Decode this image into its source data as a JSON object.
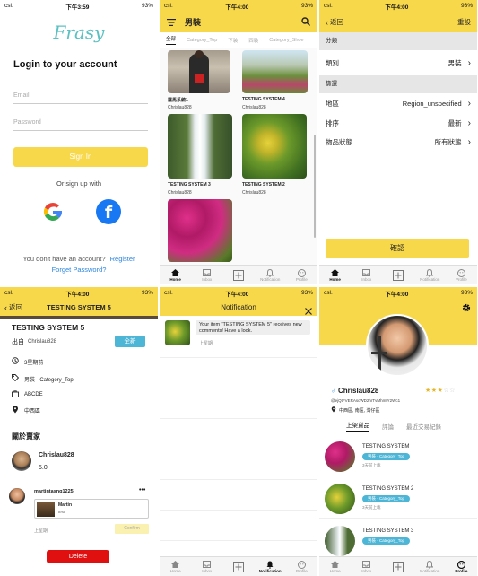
{
  "p1": {
    "status": {
      "carrier": "csl.",
      "time": "下午3:59",
      "battery": "93%"
    },
    "logo": "Frasy",
    "heading": "Login to your account",
    "email_placeholder": "Email",
    "password_placeholder": "Password",
    "signin_label": "Sign In",
    "or_signup": "Or sign up with",
    "google_letter": "G",
    "facebook_letter": "f",
    "no_account": "You don't have an account?",
    "register_label": "Register",
    "forgot_label": "Forget Password?",
    "colors": {
      "accent": "#f8d84b",
      "link": "#2e86de",
      "logo": "#5cc1c2"
    }
  },
  "p2": {
    "status": {
      "carrier": "csl.",
      "time": "下午4:00",
      "battery": "93%"
    },
    "title": "男裝",
    "tabs": [
      "全部",
      "Category_Top",
      "下装",
      "西裝",
      "Category_Shoe"
    ],
    "items": [
      {
        "title": "羅馬系統1",
        "user": "Chrislau828"
      },
      {
        "title": "TESTING SYSTEM 4",
        "user": "Chrislau828"
      },
      {
        "title": "TESTING SYSTEM 3",
        "user": "Chrislau828"
      },
      {
        "title": "TESTING SYSTEM 2",
        "user": "Chrislau828"
      }
    ],
    "nav": [
      "Home",
      "Inbox",
      "",
      "Notification",
      "Profile"
    ]
  },
  "p3": {
    "status": {
      "carrier": "csl.",
      "time": "下午4:00",
      "battery": "93%"
    },
    "back": "返回",
    "reset": "重設",
    "sec_category": "分類",
    "category_label": "類別",
    "category_value": "男裝",
    "sec_filter": "篩選",
    "region_label": "地區",
    "region_value": "Region_unspecified",
    "sort_label": "排序",
    "sort_value": "最新",
    "condition_label": "物品狀態",
    "condition_value": "所有狀態",
    "confirm": "確認",
    "nav": [
      "Home",
      "Inbox",
      "",
      "Notification",
      "Profile"
    ]
  },
  "p4": {
    "status": {
      "carrier": "csl.",
      "time": "下午4:00",
      "battery": "93%"
    },
    "back": "返回",
    "title": "TESTING SYSTEM 5",
    "item_title": "TESTING SYSTEM 5",
    "rent_label": "出自",
    "user": "Chrislau828",
    "badge": "全新",
    "time_ago": "3星期前",
    "category": "男裝 - Category_Top",
    "code": "ABCDE",
    "region": "中西區",
    "about_seller": "關於賣家",
    "seller": "Chrislau828",
    "rating": "5.0",
    "commenter": "martintasng1225",
    "more": "•••",
    "offer_name": "Martin",
    "offer_sub": "test",
    "comment_time": "上星期",
    "confirm": "Confirm",
    "delete": "Delete"
  },
  "p5": {
    "status": {
      "carrier": "csl.",
      "time": "下午4:00",
      "battery": "93%"
    },
    "title": "Notification",
    "message": "Your item \"TESTING SYSTEM 5\" receives new comments! Have a look.",
    "time": "上星期",
    "nav": [
      "Home",
      "Inbox",
      "",
      "Notification",
      "Profile"
    ]
  },
  "p6": {
    "status": {
      "carrier": "csl.",
      "time": "下午4:00",
      "battery": "93%"
    },
    "username": "Chrislau828",
    "gender": "♂",
    "uid": "@ejQtFVERAscWD2hrTvMhmtY2Wc1",
    "region": "中西區, 南區, 灣仔區",
    "rating_stars": 3,
    "rating_max": 5,
    "tabs": [
      "上架貨品",
      "評論",
      "最近交易紀錄"
    ],
    "items": [
      {
        "title": "TESTING SYSTEM",
        "chip": "男裝 - Category_Top",
        "time": "3天前上載"
      },
      {
        "title": "TESTING SYSTEM 2",
        "chip": "男裝 - Category_Top",
        "time": "3天前上載"
      },
      {
        "title": "TESTING SYSTEM 3",
        "chip": "男裝 - Category_Top",
        "time": ""
      }
    ],
    "nav": [
      "Home",
      "Inbox",
      "",
      "Notification",
      "Profile"
    ]
  }
}
